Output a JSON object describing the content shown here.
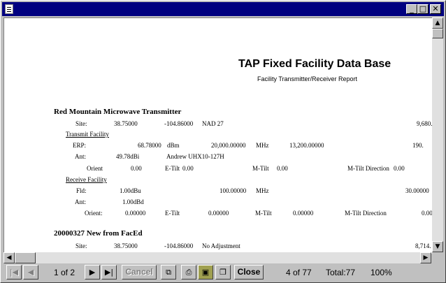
{
  "window": {
    "min_glyph": "_",
    "max_glyph": "□",
    "close_glyph": "✕"
  },
  "report": {
    "title": "TAP Fixed Facility Data Base",
    "subtitle": "Facility Transmitter/Receiver Report",
    "sections": [
      {
        "heading": "Red Mountain Microwave Transmitter",
        "site": {
          "label": "Site:",
          "lat": "38.75000",
          "lon": "-104.86000",
          "datum": "NAD 27",
          "elev": "9,680."
        },
        "transmit": {
          "heading": "Transmit Facility",
          "erp_label": "ERP:",
          "erp_value": "68.78000",
          "erp_unit": "dBm",
          "freq": "20,000.00000",
          "freq_unit": "MHz",
          "freq2": "13,200.00000",
          "right_value": "190.",
          "ant_label": "Ant:",
          "ant_gain": "49.78dBi",
          "ant_model": "Andrew UHX10-127H",
          "orient_label": "Orient",
          "orient_value": "0.00",
          "etilt_label": "E-Tilt",
          "etilt_value": "0.00",
          "mtilt_label": "M-Tilt",
          "mtilt_value": "0.00",
          "mtiltdir_label": "M-Tilt Direction",
          "mtiltdir_value": "0.00"
        },
        "receive": {
          "heading": "Receive Facility",
          "fld_label": "Fld:",
          "fld_value": "1.00dBu",
          "freq": "100.00000",
          "freq_unit": "MHz",
          "right_value": "30.00000",
          "ant_label": "Ant:",
          "ant_gain": "1.00dBd",
          "orient_label": "Orient:",
          "orient_value": "0.00000",
          "etilt_label": "E-Tilt",
          "etilt_value": "0.00000",
          "mtilt_label": "M-Tilt",
          "mtilt_value": "0.00000",
          "mtiltdir_label": "M-Tilt Direction",
          "mtiltdir_value": "0.00"
        }
      },
      {
        "heading": "20000327 New from FacEd",
        "site": {
          "label": "Site:",
          "lat": "38.75000",
          "lon": "-104.86000",
          "datum": "No Adjustment",
          "elev": "8,714."
        }
      }
    ]
  },
  "toolbar": {
    "first_icon": "first-page-icon",
    "page_indicator": "1 of 2",
    "cancel_label": "Cancel",
    "close_label": "Close",
    "record_indicator": "4 of 77",
    "total": "Total:77",
    "zoom": "100%"
  }
}
